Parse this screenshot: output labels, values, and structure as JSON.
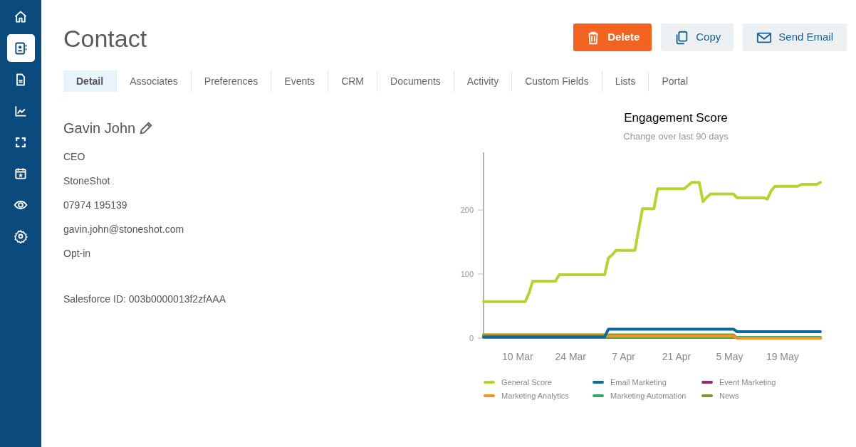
{
  "sidebar": {
    "items": [
      {
        "selected": false
      },
      {
        "selected": true
      },
      {
        "selected": false
      },
      {
        "selected": false
      },
      {
        "selected": false
      },
      {
        "selected": false
      },
      {
        "selected": false
      },
      {
        "selected": false
      }
    ]
  },
  "page": {
    "title": "Contact"
  },
  "actions": [
    {
      "kind": "delete",
      "label": "Delete"
    },
    {
      "kind": "copy",
      "label": "Copy"
    },
    {
      "kind": "email",
      "label": "Send Email"
    }
  ],
  "tabs": [
    {
      "label": "Detail",
      "selected": true
    },
    {
      "label": "Associates",
      "selected": false
    },
    {
      "label": "Preferences",
      "selected": false
    },
    {
      "label": "Events",
      "selected": false
    },
    {
      "label": "CRM",
      "selected": false
    },
    {
      "label": "Documents",
      "selected": false
    },
    {
      "label": "Activity",
      "selected": false
    },
    {
      "label": "Custom Fields",
      "selected": false
    },
    {
      "label": "Lists",
      "selected": false
    },
    {
      "label": "Portal",
      "selected": false
    }
  ],
  "contact": {
    "name": "Gavin John",
    "details": [
      "CEO",
      "StoneShot",
      "07974 195139",
      "gavin.john@stoneshot.com",
      "Opt-in"
    ],
    "salesforce_id": "Salesforce ID: 003b0000013f2zfAAA"
  },
  "engagement": {
    "chart_data": {
      "type": "line",
      "title": "Engagement Score",
      "subtitle": "Change over last 90 days",
      "categories": [
        null,
        null,
        null,
        null,
        null,
        null,
        null,
        null,
        null,
        "10 Mar",
        null,
        null,
        null,
        null,
        null,
        null,
        null,
        null,
        null,
        null,
        null,
        null,
        null,
        "24 Mar",
        null,
        null,
        null,
        null,
        null,
        null,
        null,
        null,
        null,
        null,
        null,
        null,
        null,
        "7 Apr",
        null,
        null,
        null,
        null,
        null,
        null,
        null,
        null,
        null,
        null,
        null,
        null,
        null,
        "21 Apr",
        null,
        null,
        null,
        null,
        null,
        null,
        null,
        null,
        null,
        null,
        null,
        null,
        null,
        "5 May",
        null,
        null,
        null,
        null,
        null,
        null,
        null,
        null,
        null,
        null,
        null,
        null,
        null,
        "19 May",
        null,
        null,
        null,
        null,
        null,
        null,
        null,
        null,
        null,
        null
      ],
      "ylim": [
        0,
        290
      ],
      "yticks": [
        0,
        100,
        200
      ],
      "series": [
        {
          "name": "General Score",
          "color": "#b5d334",
          "values": [
            57,
            57,
            57,
            57,
            57,
            57,
            57,
            57,
            57,
            57,
            57,
            57,
            70,
            89,
            89,
            89,
            89,
            89,
            89,
            89,
            99,
            99,
            99,
            99,
            99,
            99,
            99,
            99,
            99,
            99,
            99,
            99,
            99,
            125,
            130,
            137,
            137,
            137,
            137,
            137,
            137,
            170,
            202,
            202,
            202,
            202,
            233,
            233,
            233,
            233,
            233,
            233,
            233,
            233,
            238,
            243,
            243,
            243,
            213,
            220,
            225,
            225,
            225,
            225,
            225,
            225,
            225,
            219,
            219,
            219,
            219,
            219,
            219,
            219,
            219,
            217,
            230,
            237,
            237,
            237,
            237,
            237,
            237,
            237,
            240,
            240,
            240,
            240,
            240,
            243
          ]
        },
        {
          "name": "Email Marketing",
          "color": "#0b6a9c",
          "values": [
            2,
            2,
            2,
            2,
            2,
            2,
            2,
            2,
            2,
            2,
            2,
            2,
            2,
            2,
            2,
            2,
            2,
            2,
            2,
            2,
            2,
            2,
            2,
            2,
            2,
            2,
            2,
            2,
            2,
            2,
            2,
            2,
            2,
            14,
            14,
            14,
            14,
            14,
            14,
            14,
            14,
            14,
            14,
            14,
            14,
            14,
            14,
            14,
            14,
            14,
            14,
            14,
            14,
            14,
            14,
            14,
            14,
            14,
            14,
            14,
            14,
            14,
            14,
            14,
            14,
            14,
            14,
            10,
            10,
            10,
            10,
            10,
            10,
            10,
            10,
            10,
            10,
            10,
            10,
            10,
            10,
            10,
            10,
            10,
            10,
            10,
            10,
            10,
            10,
            10
          ]
        },
        {
          "name": "Event Marketing",
          "color": "#9b2a73",
          "values": [
            null,
            null,
            null,
            null,
            null,
            null,
            null,
            null,
            null,
            null,
            null,
            null,
            null,
            null,
            null,
            null,
            null,
            null,
            null,
            null,
            null,
            null,
            null,
            null,
            null,
            null,
            null,
            null,
            null,
            null,
            null,
            null,
            null,
            null,
            null,
            null,
            null,
            null,
            null,
            null,
            null,
            null,
            null,
            null,
            null,
            null,
            null,
            null,
            null,
            null,
            null,
            null,
            null,
            null,
            null,
            null,
            null,
            null,
            null,
            null,
            null,
            null,
            null,
            null,
            null,
            null,
            null,
            null,
            null,
            null,
            null,
            null,
            null,
            null,
            null,
            null,
            null,
            null,
            null,
            null,
            null,
            null,
            null,
            null,
            null,
            null,
            null,
            null,
            null,
            null
          ]
        },
        {
          "name": "Marketing Analytics",
          "color": "#f7931e",
          "values": [
            3,
            3,
            3,
            3,
            3,
            3,
            3,
            3,
            3,
            3,
            3,
            3,
            3,
            3,
            3,
            3,
            3,
            3,
            3,
            3,
            3,
            3,
            3,
            3,
            3,
            3,
            3,
            3,
            3,
            3,
            3,
            3,
            3,
            3,
            3,
            3,
            3,
            3,
            3,
            3,
            3,
            3,
            3,
            3,
            3,
            3,
            3,
            3,
            3,
            3,
            3,
            3,
            3,
            3,
            3,
            3,
            3,
            3,
            3,
            3,
            3,
            3,
            3,
            3,
            3,
            3,
            3,
            0,
            0,
            0,
            0,
            0,
            0,
            0,
            0,
            0,
            0,
            0,
            0,
            0,
            0,
            0,
            0,
            0,
            0,
            0,
            0,
            0,
            0,
            0
          ]
        },
        {
          "name": "Marketing Automation",
          "color": "#2ea866",
          "values": [
            1,
            1,
            1,
            1,
            1,
            1,
            1,
            1,
            1,
            1,
            1,
            1,
            1,
            1,
            1,
            1,
            1,
            1,
            1,
            1,
            1,
            1,
            1,
            1,
            1,
            1,
            1,
            1,
            1,
            1,
            1,
            1,
            1,
            1,
            1,
            1,
            1,
            1,
            1,
            1,
            1,
            1,
            1,
            1,
            1,
            1,
            1,
            1,
            1,
            1,
            1,
            1,
            1,
            1,
            1,
            1,
            1,
            1,
            1,
            1,
            1,
            1,
            1,
            1,
            1,
            1,
            1,
            1,
            1,
            1,
            1,
            1,
            1,
            1,
            1,
            1,
            1,
            1,
            1,
            1,
            1,
            1,
            1,
            1,
            1,
            1,
            1,
            1,
            1,
            1
          ]
        },
        {
          "name": "News",
          "color": "#7a9a2a",
          "values": [
            5,
            5,
            5,
            5,
            5,
            5,
            5,
            5,
            5,
            5,
            5,
            5,
            5,
            5,
            5,
            5,
            5,
            5,
            5,
            5,
            5,
            5,
            5,
            5,
            5,
            5,
            5,
            5,
            5,
            5,
            5,
            5,
            5,
            5,
            5,
            5,
            5,
            5,
            5,
            5,
            5,
            5,
            5,
            5,
            5,
            5,
            5,
            5,
            5,
            5,
            5,
            5,
            5,
            5,
            5,
            5,
            5,
            5,
            5,
            5,
            5,
            5,
            5,
            5,
            5,
            5,
            5,
            0,
            0,
            0,
            0,
            0,
            0,
            0,
            0,
            0,
            0,
            0,
            0,
            0,
            0,
            0,
            0,
            0,
            0,
            0,
            0,
            0,
            0,
            0
          ]
        }
      ]
    }
  }
}
